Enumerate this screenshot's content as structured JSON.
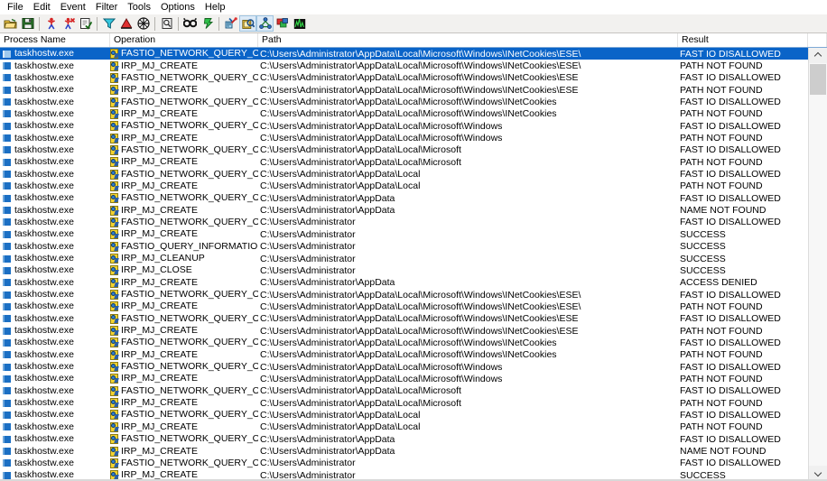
{
  "menu": {
    "items": [
      {
        "label": "File"
      },
      {
        "label": "Edit"
      },
      {
        "label": "Event"
      },
      {
        "label": "Filter"
      },
      {
        "label": "Tools"
      },
      {
        "label": "Options"
      },
      {
        "label": "Help"
      }
    ]
  },
  "toolbar": {
    "buttons": [
      {
        "name": "open-icon",
        "title": "Open"
      },
      {
        "name": "save-icon",
        "title": "Save"
      },
      {
        "name": "capture-icon",
        "title": "Capture Events"
      },
      {
        "name": "autoscroll-icon",
        "title": "Autoscroll"
      },
      {
        "name": "clear-icon",
        "title": "Clear Display"
      },
      {
        "name": "filter-icon",
        "title": "Filter"
      },
      {
        "name": "highlight-icon",
        "title": "Highlight"
      },
      {
        "name": "include-process-icon",
        "title": "Include Process From Window"
      },
      {
        "name": "properties-icon",
        "title": "Event Properties"
      },
      {
        "name": "find-icon",
        "title": "Find"
      },
      {
        "name": "jump-to-icon",
        "title": "Jump To Object"
      },
      {
        "name": "registry-activity-icon",
        "title": "Show Registry Activity"
      },
      {
        "name": "file-activity-icon",
        "title": "Show File System Activity"
      },
      {
        "name": "network-activity-icon",
        "title": "Show Network Activity"
      },
      {
        "name": "process-activity-icon",
        "title": "Show Process and Thread Activity"
      },
      {
        "name": "profiling-events-icon",
        "title": "Show Profiling Events"
      }
    ],
    "active_indices": [
      11,
      12
    ]
  },
  "columns": [
    {
      "key": "process",
      "label": "Process Name"
    },
    {
      "key": "operation",
      "label": "Operation"
    },
    {
      "key": "path",
      "label": "Path"
    },
    {
      "key": "result",
      "label": "Result"
    }
  ],
  "scrollbar": {
    "up_arrow": "˄",
    "down_arrow": "˅"
  },
  "rows": [
    {
      "process": "taskhostw.exe",
      "operation": "FASTIO_NETWORK_QUERY_O...",
      "path": "C:\\Users\\Administrator\\AppData\\Local\\Microsoft\\Windows\\INetCookies\\ESE\\",
      "result": "FAST IO DISALLOWED",
      "selected": true
    },
    {
      "process": "taskhostw.exe",
      "operation": "IRP_MJ_CREATE",
      "path": "C:\\Users\\Administrator\\AppData\\Local\\Microsoft\\Windows\\INetCookies\\ESE\\",
      "result": "PATH NOT FOUND",
      "selected": false
    },
    {
      "process": "taskhostw.exe",
      "operation": "FASTIO_NETWORK_QUERY_O...",
      "path": "C:\\Users\\Administrator\\AppData\\Local\\Microsoft\\Windows\\INetCookies\\ESE",
      "result": "FAST IO DISALLOWED",
      "selected": false
    },
    {
      "process": "taskhostw.exe",
      "operation": "IRP_MJ_CREATE",
      "path": "C:\\Users\\Administrator\\AppData\\Local\\Microsoft\\Windows\\INetCookies\\ESE",
      "result": "PATH NOT FOUND",
      "selected": false
    },
    {
      "process": "taskhostw.exe",
      "operation": "FASTIO_NETWORK_QUERY_O...",
      "path": "C:\\Users\\Administrator\\AppData\\Local\\Microsoft\\Windows\\INetCookies",
      "result": "FAST IO DISALLOWED",
      "selected": false
    },
    {
      "process": "taskhostw.exe",
      "operation": "IRP_MJ_CREATE",
      "path": "C:\\Users\\Administrator\\AppData\\Local\\Microsoft\\Windows\\INetCookies",
      "result": "PATH NOT FOUND",
      "selected": false
    },
    {
      "process": "taskhostw.exe",
      "operation": "FASTIO_NETWORK_QUERY_O...",
      "path": "C:\\Users\\Administrator\\AppData\\Local\\Microsoft\\Windows",
      "result": "FAST IO DISALLOWED",
      "selected": false
    },
    {
      "process": "taskhostw.exe",
      "operation": "IRP_MJ_CREATE",
      "path": "C:\\Users\\Administrator\\AppData\\Local\\Microsoft\\Windows",
      "result": "PATH NOT FOUND",
      "selected": false
    },
    {
      "process": "taskhostw.exe",
      "operation": "FASTIO_NETWORK_QUERY_O...",
      "path": "C:\\Users\\Administrator\\AppData\\Local\\Microsoft",
      "result": "FAST IO DISALLOWED",
      "selected": false
    },
    {
      "process": "taskhostw.exe",
      "operation": "IRP_MJ_CREATE",
      "path": "C:\\Users\\Administrator\\AppData\\Local\\Microsoft",
      "result": "PATH NOT FOUND",
      "selected": false
    },
    {
      "process": "taskhostw.exe",
      "operation": "FASTIO_NETWORK_QUERY_O...",
      "path": "C:\\Users\\Administrator\\AppData\\Local",
      "result": "FAST IO DISALLOWED",
      "selected": false
    },
    {
      "process": "taskhostw.exe",
      "operation": "IRP_MJ_CREATE",
      "path": "C:\\Users\\Administrator\\AppData\\Local",
      "result": "PATH NOT FOUND",
      "selected": false
    },
    {
      "process": "taskhostw.exe",
      "operation": "FASTIO_NETWORK_QUERY_O...",
      "path": "C:\\Users\\Administrator\\AppData",
      "result": "FAST IO DISALLOWED",
      "selected": false
    },
    {
      "process": "taskhostw.exe",
      "operation": "IRP_MJ_CREATE",
      "path": "C:\\Users\\Administrator\\AppData",
      "result": "NAME NOT FOUND",
      "selected": false
    },
    {
      "process": "taskhostw.exe",
      "operation": "FASTIO_NETWORK_QUERY_O...",
      "path": "C:\\Users\\Administrator",
      "result": "FAST IO DISALLOWED",
      "selected": false
    },
    {
      "process": "taskhostw.exe",
      "operation": "IRP_MJ_CREATE",
      "path": "C:\\Users\\Administrator",
      "result": "SUCCESS",
      "selected": false
    },
    {
      "process": "taskhostw.exe",
      "operation": "FASTIO_QUERY_INFORMATION",
      "path": "C:\\Users\\Administrator",
      "result": "SUCCESS",
      "selected": false
    },
    {
      "process": "taskhostw.exe",
      "operation": "IRP_MJ_CLEANUP",
      "path": "C:\\Users\\Administrator",
      "result": "SUCCESS",
      "selected": false
    },
    {
      "process": "taskhostw.exe",
      "operation": "IRP_MJ_CLOSE",
      "path": "C:\\Users\\Administrator",
      "result": "SUCCESS",
      "selected": false
    },
    {
      "process": "taskhostw.exe",
      "operation": "IRP_MJ_CREATE",
      "path": "C:\\Users\\Administrator\\AppData",
      "result": "ACCESS DENIED",
      "selected": false
    },
    {
      "process": "taskhostw.exe",
      "operation": "FASTIO_NETWORK_QUERY_O...",
      "path": "C:\\Users\\Administrator\\AppData\\Local\\Microsoft\\Windows\\INetCookies\\ESE\\",
      "result": "FAST IO DISALLOWED",
      "selected": false
    },
    {
      "process": "taskhostw.exe",
      "operation": "IRP_MJ_CREATE",
      "path": "C:\\Users\\Administrator\\AppData\\Local\\Microsoft\\Windows\\INetCookies\\ESE\\",
      "result": "PATH NOT FOUND",
      "selected": false
    },
    {
      "process": "taskhostw.exe",
      "operation": "FASTIO_NETWORK_QUERY_O...",
      "path": "C:\\Users\\Administrator\\AppData\\Local\\Microsoft\\Windows\\INetCookies\\ESE",
      "result": "FAST IO DISALLOWED",
      "selected": false
    },
    {
      "process": "taskhostw.exe",
      "operation": "IRP_MJ_CREATE",
      "path": "C:\\Users\\Administrator\\AppData\\Local\\Microsoft\\Windows\\INetCookies\\ESE",
      "result": "PATH NOT FOUND",
      "selected": false
    },
    {
      "process": "taskhostw.exe",
      "operation": "FASTIO_NETWORK_QUERY_O...",
      "path": "C:\\Users\\Administrator\\AppData\\Local\\Microsoft\\Windows\\INetCookies",
      "result": "FAST IO DISALLOWED",
      "selected": false
    },
    {
      "process": "taskhostw.exe",
      "operation": "IRP_MJ_CREATE",
      "path": "C:\\Users\\Administrator\\AppData\\Local\\Microsoft\\Windows\\INetCookies",
      "result": "PATH NOT FOUND",
      "selected": false
    },
    {
      "process": "taskhostw.exe",
      "operation": "FASTIO_NETWORK_QUERY_O...",
      "path": "C:\\Users\\Administrator\\AppData\\Local\\Microsoft\\Windows",
      "result": "FAST IO DISALLOWED",
      "selected": false
    },
    {
      "process": "taskhostw.exe",
      "operation": "IRP_MJ_CREATE",
      "path": "C:\\Users\\Administrator\\AppData\\Local\\Microsoft\\Windows",
      "result": "PATH NOT FOUND",
      "selected": false
    },
    {
      "process": "taskhostw.exe",
      "operation": "FASTIO_NETWORK_QUERY_O...",
      "path": "C:\\Users\\Administrator\\AppData\\Local\\Microsoft",
      "result": "FAST IO DISALLOWED",
      "selected": false
    },
    {
      "process": "taskhostw.exe",
      "operation": "IRP_MJ_CREATE",
      "path": "C:\\Users\\Administrator\\AppData\\Local\\Microsoft",
      "result": "PATH NOT FOUND",
      "selected": false
    },
    {
      "process": "taskhostw.exe",
      "operation": "FASTIO_NETWORK_QUERY_O...",
      "path": "C:\\Users\\Administrator\\AppData\\Local",
      "result": "FAST IO DISALLOWED",
      "selected": false
    },
    {
      "process": "taskhostw.exe",
      "operation": "IRP_MJ_CREATE",
      "path": "C:\\Users\\Administrator\\AppData\\Local",
      "result": "PATH NOT FOUND",
      "selected": false
    },
    {
      "process": "taskhostw.exe",
      "operation": "FASTIO_NETWORK_QUERY_O...",
      "path": "C:\\Users\\Administrator\\AppData",
      "result": "FAST IO DISALLOWED",
      "selected": false
    },
    {
      "process": "taskhostw.exe",
      "operation": "IRP_MJ_CREATE",
      "path": "C:\\Users\\Administrator\\AppData",
      "result": "NAME NOT FOUND",
      "selected": false
    },
    {
      "process": "taskhostw.exe",
      "operation": "FASTIO_NETWORK_QUERY_O...",
      "path": "C:\\Users\\Administrator",
      "result": "FAST IO DISALLOWED",
      "selected": false
    },
    {
      "process": "taskhostw.exe",
      "operation": "IRP_MJ_CREATE",
      "path": "C:\\Users\\Administrator",
      "result": "SUCCESS",
      "selected": false
    }
  ]
}
